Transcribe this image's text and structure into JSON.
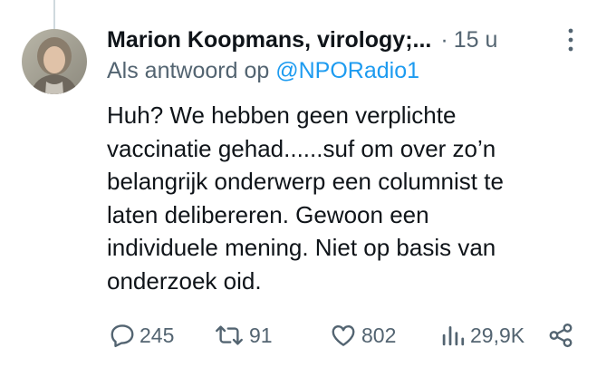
{
  "tweet": {
    "author_name": "Marion Koopmans, virology;...",
    "separator": "·",
    "timestamp": "15 u",
    "reply_prefix": "Als antwoord op",
    "reply_handle": "@NPORadio1",
    "text_lines": [
      "Huh? We hebben geen verplichte",
      "vaccinatie gehad......suf om over zo’n",
      "belangrijk onderwerp een  columnist te",
      "laten delibereren. Gewoon een",
      "individuele mening. Niet op basis van",
      "onderzoek oid."
    ]
  },
  "actions": {
    "reply_count": "245",
    "retweet_count": "91",
    "like_count": "802",
    "views_count": "29,9K"
  },
  "icons": {
    "reply": "speech-bubble-icon",
    "retweet": "retweet-icon",
    "like": "heart-icon",
    "views": "bar-chart-icon",
    "share": "share-icon",
    "more": "vertical-dots-icon"
  },
  "colors": {
    "text": "#0f1419",
    "secondary": "#536471",
    "link": "#1d9bf0"
  }
}
